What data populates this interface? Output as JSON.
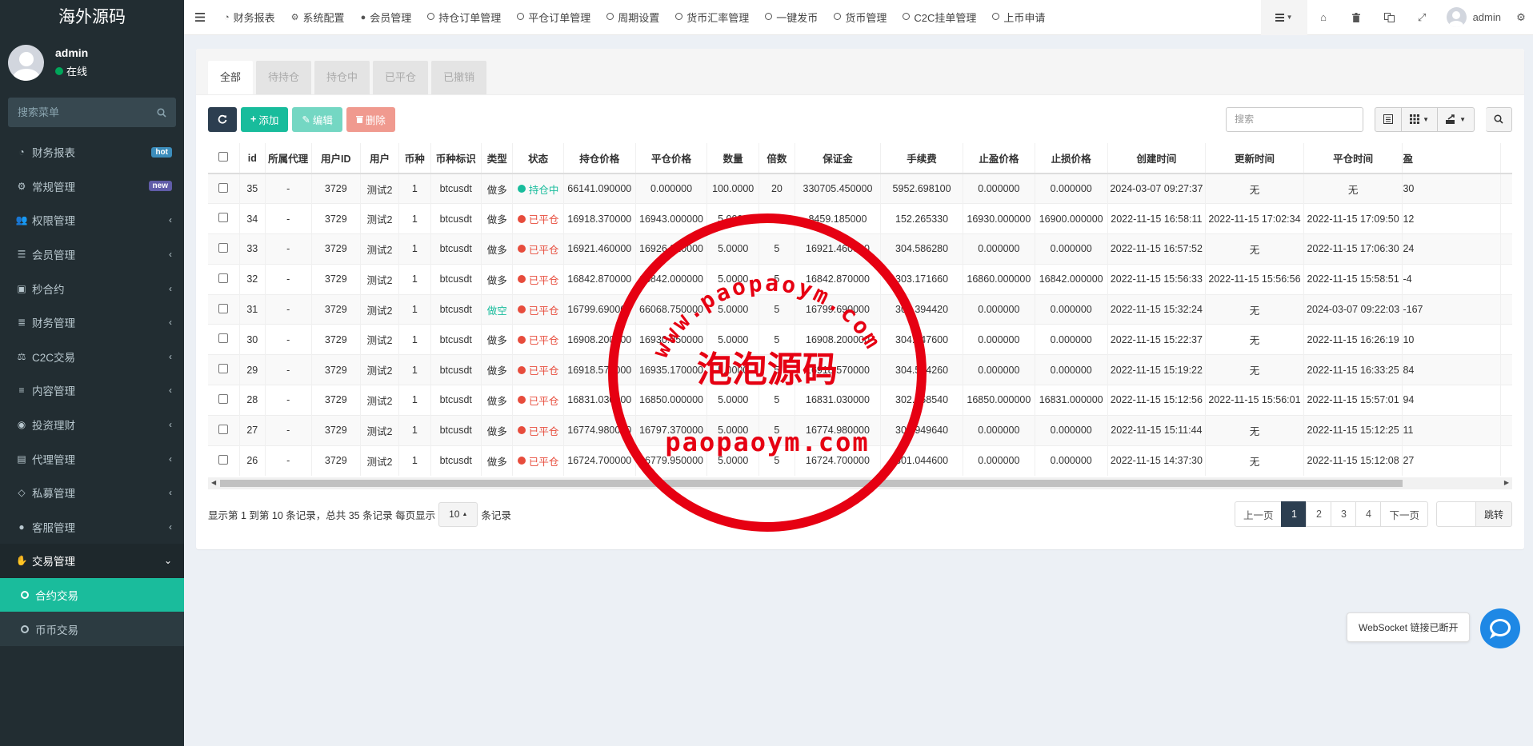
{
  "brand": "海外源码",
  "user": {
    "name": "admin",
    "status": "在线",
    "status_color": "#00a65a"
  },
  "sidebar": {
    "search_placeholder": "搜索菜单",
    "items": [
      {
        "label": "财务报表",
        "icon": "dashboard-icon",
        "badge": "hot",
        "badge_color": "#3c8dbc"
      },
      {
        "label": "常规管理",
        "icon": "cogs-icon",
        "badge": "new",
        "badge_color": "#605ca8"
      },
      {
        "label": "权限管理",
        "icon": "group-icon"
      },
      {
        "label": "会员管理",
        "icon": "list-icon"
      },
      {
        "label": "秒合约",
        "icon": "calendar-icon"
      },
      {
        "label": "财务管理",
        "icon": "database-icon"
      },
      {
        "label": "C2C交易",
        "icon": "balance-icon"
      },
      {
        "label": "内容管理",
        "icon": "align-icon"
      },
      {
        "label": "投资理财",
        "icon": "compass-icon"
      },
      {
        "label": "代理管理",
        "icon": "briefcase-icon"
      },
      {
        "label": "私募管理",
        "icon": "diamond-icon"
      },
      {
        "label": "客服管理",
        "icon": "comment-icon"
      },
      {
        "label": "交易管理",
        "icon": "handshake-icon"
      }
    ],
    "sub_items": [
      {
        "label": "合约交易"
      },
      {
        "label": "币币交易"
      }
    ]
  },
  "topnav": {
    "tabs": [
      {
        "label": "财务报表",
        "icon": "dashboard-icon"
      },
      {
        "label": "系统配置",
        "icon": "cog-icon"
      },
      {
        "label": "会员管理",
        "icon": "user-icon"
      },
      {
        "label": "持仓订单管理",
        "icon": "circle-icon"
      },
      {
        "label": "平仓订单管理",
        "icon": "circle-icon"
      },
      {
        "label": "周期设置",
        "icon": "circle-icon"
      },
      {
        "label": "货币汇率管理",
        "icon": "circle-icon"
      },
      {
        "label": "一键发币",
        "icon": "circle-icon"
      },
      {
        "label": "货币管理",
        "icon": "circle-icon"
      },
      {
        "label": "C2C挂单管理",
        "icon": "circle-icon"
      },
      {
        "label": "上币申请",
        "icon": "circle-icon"
      }
    ],
    "user_name": "admin"
  },
  "status_tabs": [
    "全部",
    "待持仓",
    "持仓中",
    "已平仓",
    "已撤销"
  ],
  "toolbar": {
    "add_label": "添加",
    "edit_label": "编辑",
    "delete_label": "删除",
    "search_placeholder": "搜索"
  },
  "table": {
    "headers": [
      "id",
      "所属代理",
      "用户ID",
      "用户",
      "币种",
      "币种标识",
      "类型",
      "状态",
      "持仓价格",
      "平仓价格",
      "数量",
      "倍数",
      "保证金",
      "手续费",
      "止盈价格",
      "止损价格",
      "创建时间",
      "更新时间",
      "平仓时间",
      "盈"
    ],
    "rows": [
      [
        "35",
        "-",
        "3729",
        "测试2",
        "1",
        "btcusdt",
        "做多",
        "持仓中",
        "66141.090000",
        "0.000000",
        "100.0000",
        "20",
        "330705.450000",
        "5952.698100",
        "0.000000",
        "0.000000",
        "2024-03-07 09:27:37",
        "无",
        "无",
        "30"
      ],
      [
        "34",
        "-",
        "3729",
        "测试2",
        "1",
        "btcusdt",
        "做多",
        "已平仓",
        "16918.370000",
        "16943.000000",
        "5.0000",
        "10",
        "8459.185000",
        "152.265330",
        "16930.000000",
        "16900.000000",
        "2022-11-15 16:58:11",
        "2022-11-15 17:02:34",
        "2022-11-15 17:09:50",
        "12"
      ],
      [
        "33",
        "-",
        "3729",
        "测试2",
        "1",
        "btcusdt",
        "做多",
        "已平仓",
        "16921.460000",
        "16926.310000",
        "5.0000",
        "5",
        "16921.460000",
        "304.586280",
        "0.000000",
        "0.000000",
        "2022-11-15 16:57:52",
        "无",
        "2022-11-15 17:06:30",
        "24"
      ],
      [
        "32",
        "-",
        "3729",
        "测试2",
        "1",
        "btcusdt",
        "做多",
        "已平仓",
        "16842.870000",
        "16842.000000",
        "5.0000",
        "5",
        "16842.870000",
        "303.171660",
        "16860.000000",
        "16842.000000",
        "2022-11-15 15:56:33",
        "2022-11-15 15:56:56",
        "2022-11-15 15:58:51",
        "-4"
      ],
      [
        "31",
        "-",
        "3729",
        "测试2",
        "1",
        "btcusdt",
        "做空",
        "已平仓",
        "16799.690000",
        "66068.750000",
        "5.0000",
        "5",
        "16799.690000",
        "302.394420",
        "0.000000",
        "0.000000",
        "2022-11-15 15:32:24",
        "无",
        "2024-03-07 09:22:03",
        "-167"
      ],
      [
        "30",
        "-",
        "3729",
        "测试2",
        "1",
        "btcusdt",
        "做多",
        "已平仓",
        "16908.200000",
        "16930.050000",
        "5.0000",
        "5",
        "16908.200000",
        "304.347600",
        "0.000000",
        "0.000000",
        "2022-11-15 15:22:37",
        "无",
        "2022-11-15 16:26:19",
        "10"
      ],
      [
        "29",
        "-",
        "3729",
        "测试2",
        "1",
        "btcusdt",
        "做多",
        "已平仓",
        "16918.570000",
        "16935.170000",
        "5.0000",
        "5",
        "16918.570000",
        "304.534260",
        "0.000000",
        "0.000000",
        "2022-11-15 15:19:22",
        "无",
        "2022-11-15 16:33:25",
        "84"
      ],
      [
        "28",
        "-",
        "3729",
        "测试2",
        "1",
        "btcusdt",
        "做多",
        "已平仓",
        "16831.030000",
        "16850.000000",
        "5.0000",
        "5",
        "16831.030000",
        "302.958540",
        "16850.000000",
        "16831.000000",
        "2022-11-15 15:12:56",
        "2022-11-15 15:56:01",
        "2022-11-15 15:57:01",
        "94"
      ],
      [
        "27",
        "-",
        "3729",
        "测试2",
        "1",
        "btcusdt",
        "做多",
        "已平仓",
        "16774.980000",
        "16797.370000",
        "5.0000",
        "5",
        "16774.980000",
        "301.949640",
        "0.000000",
        "0.000000",
        "2022-11-15 15:11:44",
        "无",
        "2022-11-15 15:12:25",
        "11"
      ],
      [
        "26",
        "-",
        "3729",
        "测试2",
        "1",
        "btcusdt",
        "做多",
        "已平仓",
        "16724.700000",
        "16779.950000",
        "5.0000",
        "5",
        "16724.700000",
        "301.044600",
        "0.000000",
        "0.000000",
        "2022-11-15 14:37:30",
        "无",
        "2022-11-15 15:12:08",
        "27"
      ]
    ]
  },
  "pager": {
    "info_prefix": "显示第 1 到第 10 条记录，总共 35 条记录 每页显示",
    "page_size": "10",
    "info_suffix": "条记录",
    "prev": "上一页",
    "pages": [
      "1",
      "2",
      "3",
      "4"
    ],
    "next": "下一页",
    "jump": "跳转"
  },
  "watermark": {
    "top_text": "www.paopaoym.com",
    "center_text": "泡泡源码",
    "bottom_text": "paopaoym.com",
    "color": "#e60012"
  },
  "websocket_toast": "WebSocket 链接已断开",
  "colors": {
    "sidebar_bg": "#222d32",
    "accent": "#1abc9c",
    "status_open": "#18bc9c",
    "status_closed": "#e74c3c",
    "primary_dark": "#2c3e50"
  }
}
